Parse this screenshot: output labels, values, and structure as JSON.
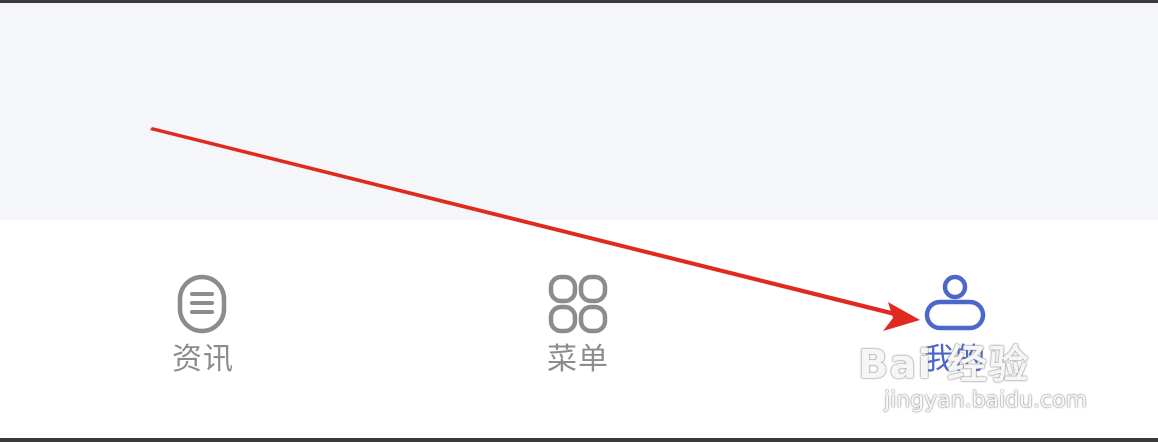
{
  "tab_bar": {
    "items": [
      {
        "label": "资讯",
        "icon": "news-icon",
        "active": false
      },
      {
        "label": "菜单",
        "icon": "grid-menu-icon",
        "active": false
      },
      {
        "label": "我的",
        "icon": "user-profile-icon",
        "active": true
      }
    ]
  },
  "colors": {
    "inactive": "#8c8c8c",
    "active": "#4a67c9",
    "content_background": "#f5f6fa",
    "tab_bar_background": "#ffffff",
    "annotation_arrow": "#e02a1f"
  },
  "watermark": {
    "brand": "Bai 经验",
    "url": "jingyan.baidu.com"
  }
}
